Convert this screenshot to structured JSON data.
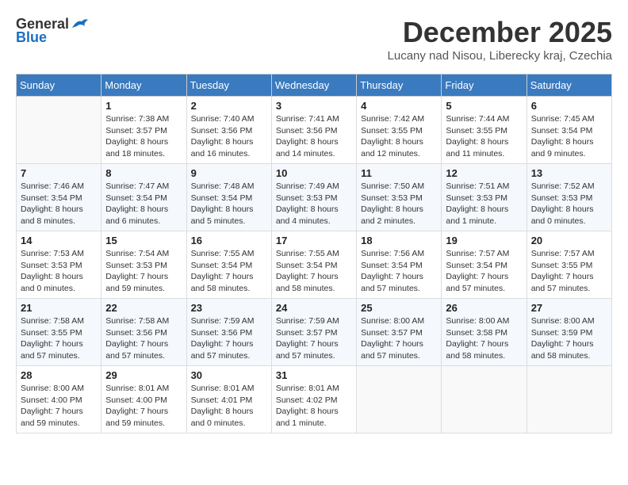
{
  "header": {
    "logo_general": "General",
    "logo_blue": "Blue",
    "title": "December 2025",
    "subtitle": "Lucany nad Nisou, Liberecky kraj, Czechia"
  },
  "calendar": {
    "days_of_week": [
      "Sunday",
      "Monday",
      "Tuesday",
      "Wednesday",
      "Thursday",
      "Friday",
      "Saturday"
    ],
    "weeks": [
      [
        {
          "day": "",
          "info": ""
        },
        {
          "day": "1",
          "info": "Sunrise: 7:38 AM\nSunset: 3:57 PM\nDaylight: 8 hours\nand 18 minutes."
        },
        {
          "day": "2",
          "info": "Sunrise: 7:40 AM\nSunset: 3:56 PM\nDaylight: 8 hours\nand 16 minutes."
        },
        {
          "day": "3",
          "info": "Sunrise: 7:41 AM\nSunset: 3:56 PM\nDaylight: 8 hours\nand 14 minutes."
        },
        {
          "day": "4",
          "info": "Sunrise: 7:42 AM\nSunset: 3:55 PM\nDaylight: 8 hours\nand 12 minutes."
        },
        {
          "day": "5",
          "info": "Sunrise: 7:44 AM\nSunset: 3:55 PM\nDaylight: 8 hours\nand 11 minutes."
        },
        {
          "day": "6",
          "info": "Sunrise: 7:45 AM\nSunset: 3:54 PM\nDaylight: 8 hours\nand 9 minutes."
        }
      ],
      [
        {
          "day": "7",
          "info": "Sunrise: 7:46 AM\nSunset: 3:54 PM\nDaylight: 8 hours\nand 8 minutes."
        },
        {
          "day": "8",
          "info": "Sunrise: 7:47 AM\nSunset: 3:54 PM\nDaylight: 8 hours\nand 6 minutes."
        },
        {
          "day": "9",
          "info": "Sunrise: 7:48 AM\nSunset: 3:54 PM\nDaylight: 8 hours\nand 5 minutes."
        },
        {
          "day": "10",
          "info": "Sunrise: 7:49 AM\nSunset: 3:53 PM\nDaylight: 8 hours\nand 4 minutes."
        },
        {
          "day": "11",
          "info": "Sunrise: 7:50 AM\nSunset: 3:53 PM\nDaylight: 8 hours\nand 2 minutes."
        },
        {
          "day": "12",
          "info": "Sunrise: 7:51 AM\nSunset: 3:53 PM\nDaylight: 8 hours\nand 1 minute."
        },
        {
          "day": "13",
          "info": "Sunrise: 7:52 AM\nSunset: 3:53 PM\nDaylight: 8 hours\nand 0 minutes."
        }
      ],
      [
        {
          "day": "14",
          "info": "Sunrise: 7:53 AM\nSunset: 3:53 PM\nDaylight: 8 hours\nand 0 minutes."
        },
        {
          "day": "15",
          "info": "Sunrise: 7:54 AM\nSunset: 3:53 PM\nDaylight: 7 hours\nand 59 minutes."
        },
        {
          "day": "16",
          "info": "Sunrise: 7:55 AM\nSunset: 3:54 PM\nDaylight: 7 hours\nand 58 minutes."
        },
        {
          "day": "17",
          "info": "Sunrise: 7:55 AM\nSunset: 3:54 PM\nDaylight: 7 hours\nand 58 minutes."
        },
        {
          "day": "18",
          "info": "Sunrise: 7:56 AM\nSunset: 3:54 PM\nDaylight: 7 hours\nand 57 minutes."
        },
        {
          "day": "19",
          "info": "Sunrise: 7:57 AM\nSunset: 3:54 PM\nDaylight: 7 hours\nand 57 minutes."
        },
        {
          "day": "20",
          "info": "Sunrise: 7:57 AM\nSunset: 3:55 PM\nDaylight: 7 hours\nand 57 minutes."
        }
      ],
      [
        {
          "day": "21",
          "info": "Sunrise: 7:58 AM\nSunset: 3:55 PM\nDaylight: 7 hours\nand 57 minutes."
        },
        {
          "day": "22",
          "info": "Sunrise: 7:58 AM\nSunset: 3:56 PM\nDaylight: 7 hours\nand 57 minutes."
        },
        {
          "day": "23",
          "info": "Sunrise: 7:59 AM\nSunset: 3:56 PM\nDaylight: 7 hours\nand 57 minutes."
        },
        {
          "day": "24",
          "info": "Sunrise: 7:59 AM\nSunset: 3:57 PM\nDaylight: 7 hours\nand 57 minutes."
        },
        {
          "day": "25",
          "info": "Sunrise: 8:00 AM\nSunset: 3:57 PM\nDaylight: 7 hours\nand 57 minutes."
        },
        {
          "day": "26",
          "info": "Sunrise: 8:00 AM\nSunset: 3:58 PM\nDaylight: 7 hours\nand 58 minutes."
        },
        {
          "day": "27",
          "info": "Sunrise: 8:00 AM\nSunset: 3:59 PM\nDaylight: 7 hours\nand 58 minutes."
        }
      ],
      [
        {
          "day": "28",
          "info": "Sunrise: 8:00 AM\nSunset: 4:00 PM\nDaylight: 7 hours\nand 59 minutes."
        },
        {
          "day": "29",
          "info": "Sunrise: 8:01 AM\nSunset: 4:00 PM\nDaylight: 7 hours\nand 59 minutes."
        },
        {
          "day": "30",
          "info": "Sunrise: 8:01 AM\nSunset: 4:01 PM\nDaylight: 8 hours\nand 0 minutes."
        },
        {
          "day": "31",
          "info": "Sunrise: 8:01 AM\nSunset: 4:02 PM\nDaylight: 8 hours\nand 1 minute."
        },
        {
          "day": "",
          "info": ""
        },
        {
          "day": "",
          "info": ""
        },
        {
          "day": "",
          "info": ""
        }
      ]
    ]
  }
}
